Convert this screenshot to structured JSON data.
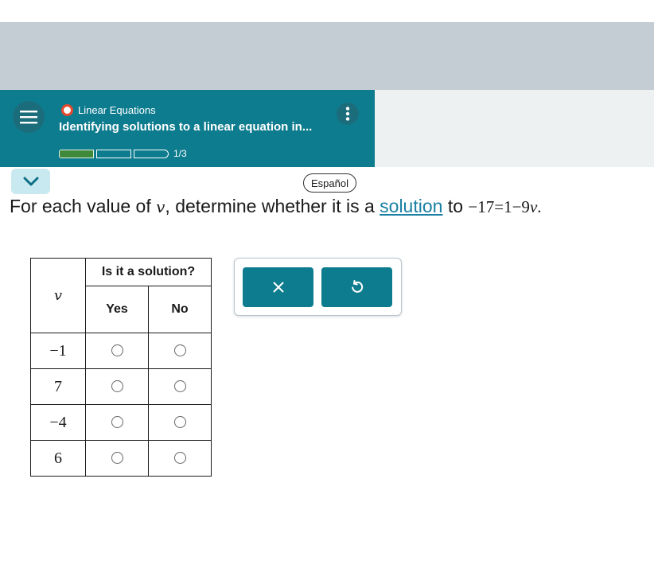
{
  "header": {
    "topic_label": "Linear Equations",
    "subtitle": "Identifying solutions to a linear equation in...",
    "progress_text": "1/3",
    "progress_filled_segments": 1,
    "progress_total_segments": 3,
    "colors": {
      "header_bg": "#0e7c8f",
      "topic_dot": "#e8492d",
      "progress_fill": "#3f8a3a"
    }
  },
  "language_button": "Español",
  "question": {
    "prefix": "For each value of ",
    "variable": "v",
    "middle": ", determine whether it is a ",
    "link_text": "solution",
    "to_text": " to ",
    "eq_left": "−17=1−9",
    "eq_var": "v",
    "eq_end": "."
  },
  "table": {
    "column_var": "v",
    "group_header": "Is it a solution?",
    "yes_label": "Yes",
    "no_label": "No",
    "rows": [
      "−1",
      "7",
      "−4",
      "6"
    ]
  },
  "icons": {
    "menu": "hamburger-menu-icon",
    "more": "vertical-dots-icon",
    "collapse": "chevron-down-icon",
    "clear": "close-icon",
    "undo": "undo-icon"
  }
}
